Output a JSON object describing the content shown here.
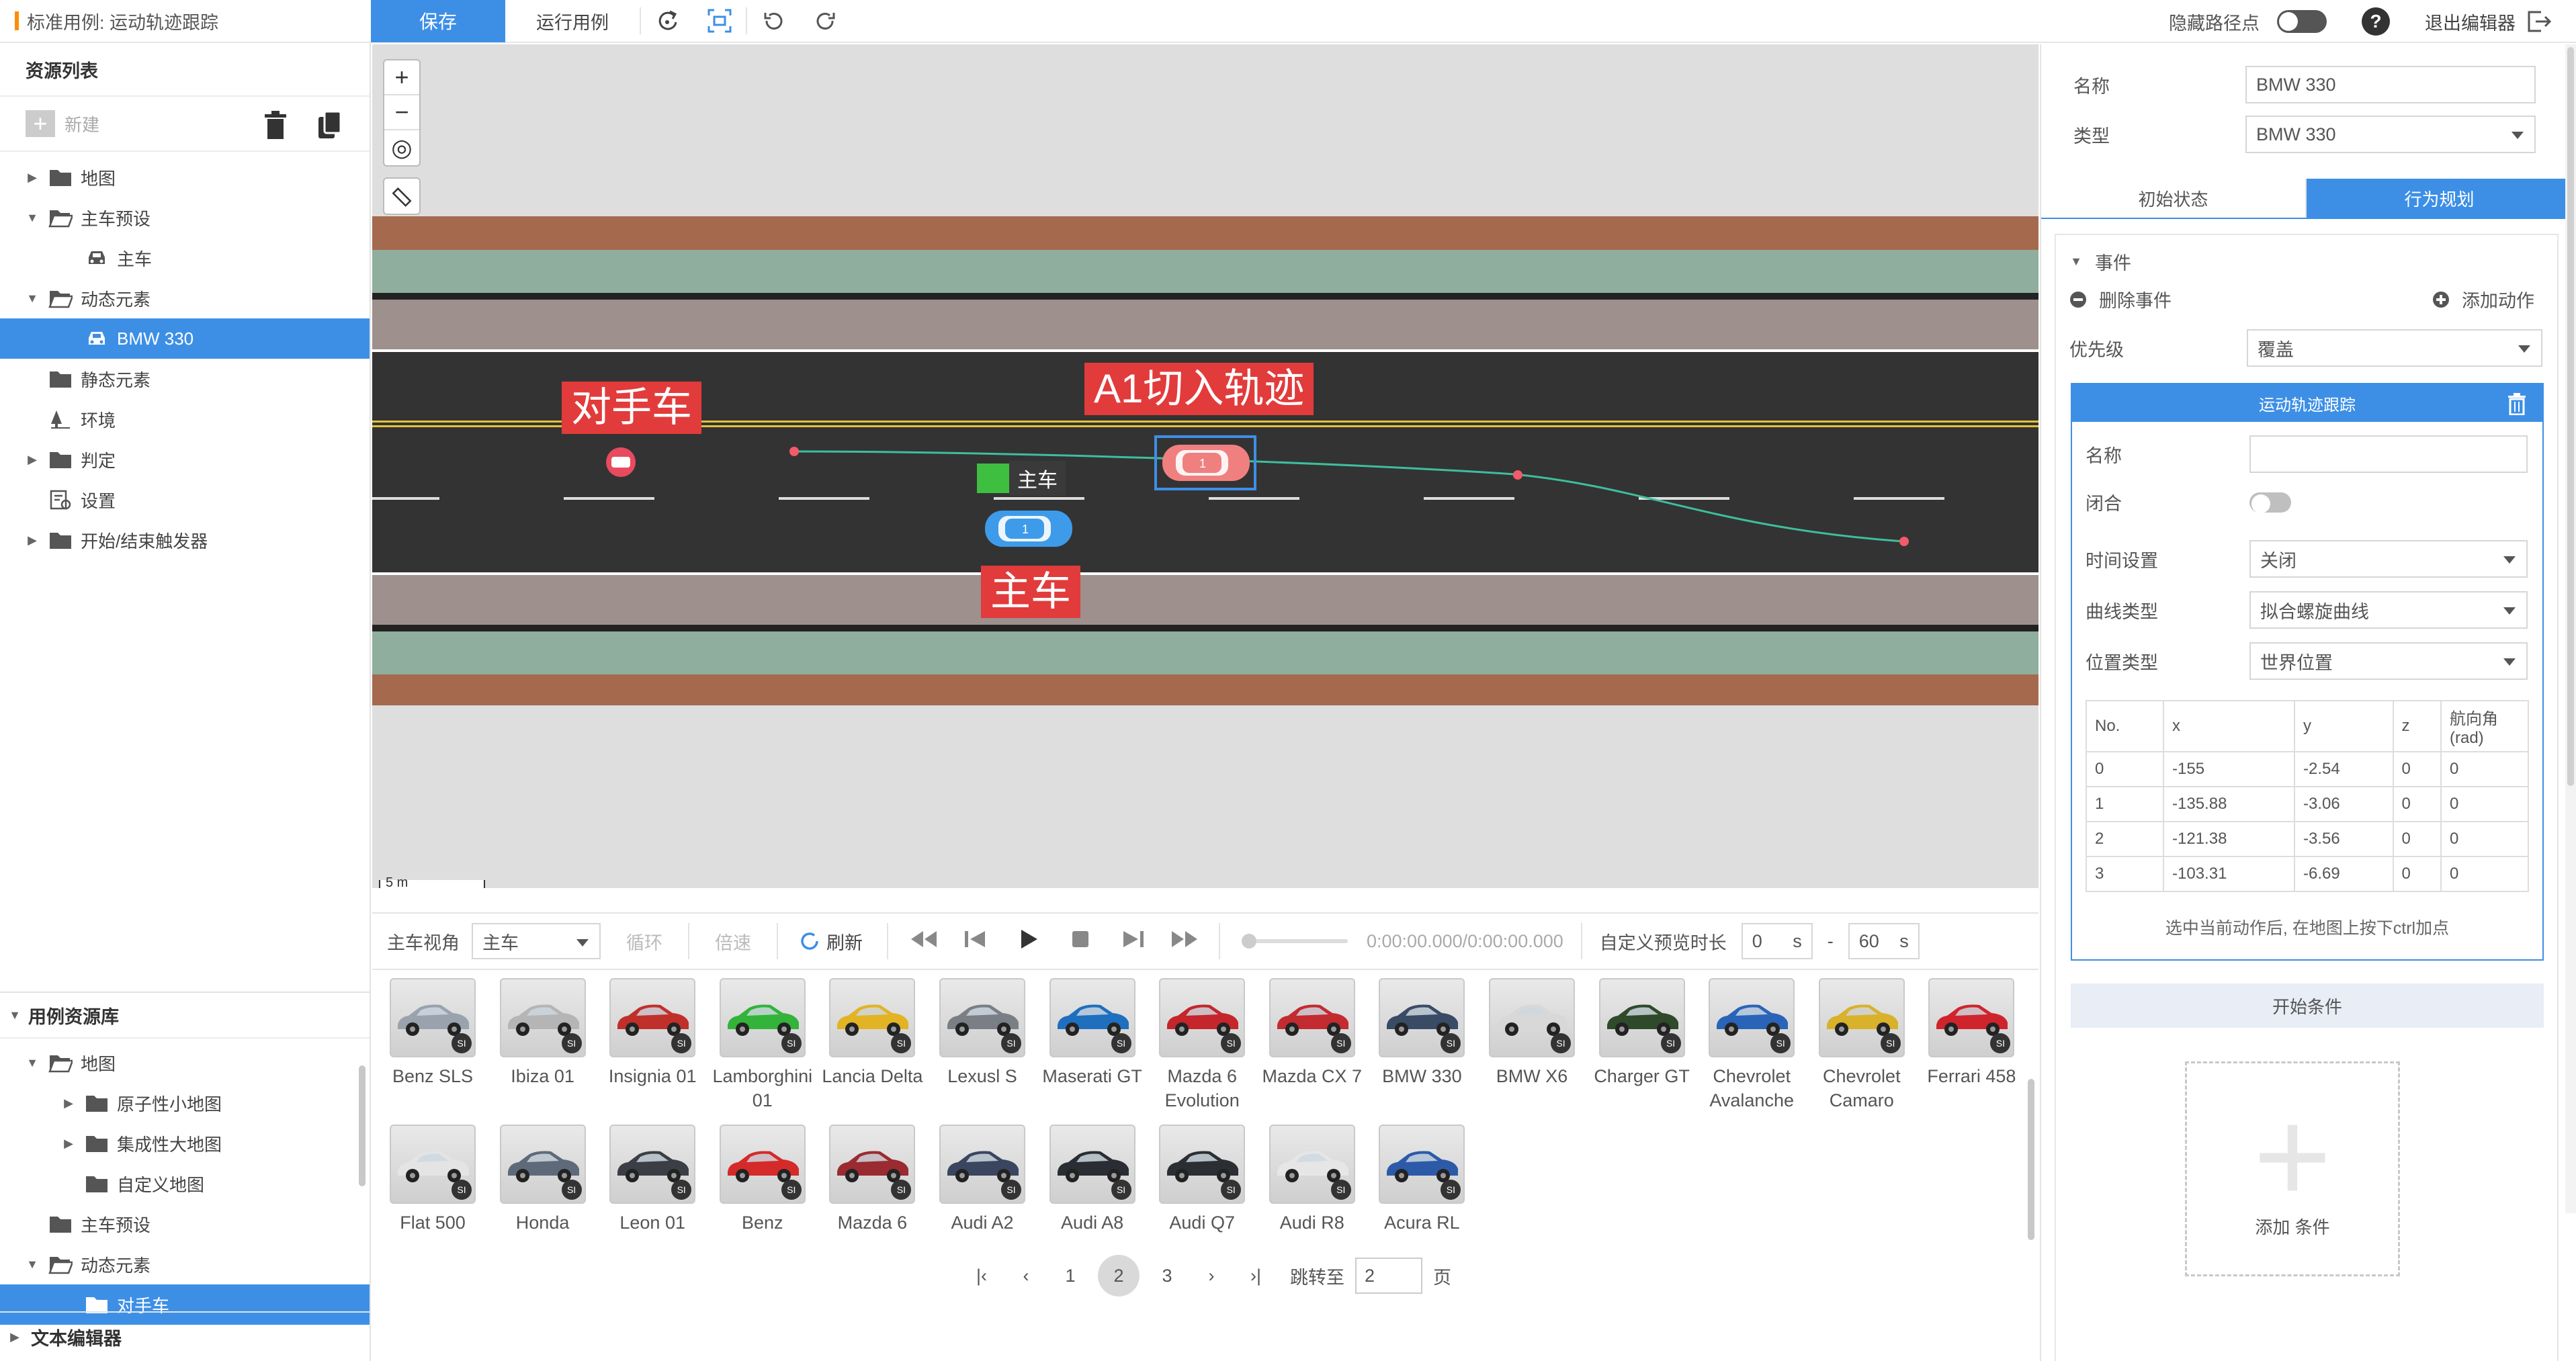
{
  "title_bar": {
    "title": "标准用例: 运动轨迹跟踪",
    "accent_color": "#ff8c00"
  },
  "toolbar": {
    "save_label": "保存",
    "run_label": "运行用例",
    "icons": [
      "refresh-route-icon",
      "fit-screen-icon",
      "undo-icon",
      "redo-icon"
    ],
    "hide_waypoints_label": "隐藏路径点",
    "help_label": "?",
    "exit_label": "退出编辑器"
  },
  "resources": {
    "title": "资源列表",
    "new_label": "新建",
    "tree": [
      {
        "label": "地图",
        "depth": 0,
        "caret": "▶",
        "icon": "folder"
      },
      {
        "label": "主车预设",
        "depth": 0,
        "caret": "▼",
        "icon": "folder-open"
      },
      {
        "label": "主车",
        "depth": 1,
        "caret": "",
        "icon": "car"
      },
      {
        "label": "动态元素",
        "depth": 0,
        "caret": "▼",
        "icon": "folder-open"
      },
      {
        "label": "BMW 330",
        "depth": 1,
        "caret": "",
        "icon": "car",
        "selected": true
      },
      {
        "label": "静态元素",
        "depth": 0,
        "caret": "",
        "icon": "folder"
      },
      {
        "label": "环境",
        "depth": 0,
        "caret": "",
        "icon": "tree"
      },
      {
        "label": "判定",
        "depth": 0,
        "caret": "▶",
        "icon": "folder"
      },
      {
        "label": "设置",
        "depth": 0,
        "caret": "",
        "icon": "settings"
      },
      {
        "label": "开始/结束触发器",
        "depth": 0,
        "caret": "▶",
        "icon": "folder"
      }
    ]
  },
  "case_library": {
    "title": "用例资源库",
    "tree": [
      {
        "label": "地图",
        "depth": 0,
        "caret": "▼",
        "icon": "folder-open"
      },
      {
        "label": "原子性小地图",
        "depth": 1,
        "caret": "▶",
        "icon": "folder"
      },
      {
        "label": "集成性大地图",
        "depth": 1,
        "caret": "▶",
        "icon": "folder"
      },
      {
        "label": "自定义地图",
        "depth": 1,
        "caret": "",
        "icon": "folder"
      },
      {
        "label": "主车预设",
        "depth": 0,
        "caret": "",
        "icon": "folder"
      },
      {
        "label": "动态元素",
        "depth": 0,
        "caret": "▼",
        "icon": "folder-open"
      },
      {
        "label": "对手车",
        "depth": 1,
        "caret": "",
        "icon": "folder",
        "selected": true
      }
    ]
  },
  "text_editor": {
    "label": "文本编辑器"
  },
  "map": {
    "zoom_in": "+",
    "zoom_out": "−",
    "annotations": {
      "opponent": "对手车",
      "trajectory": "A1切入轨迹",
      "ego": "主车"
    },
    "ego_tag": "主车",
    "scale_label": "5 m"
  },
  "playback": {
    "view_label": "主车视角",
    "view_value": "主车",
    "loop_label": "循环",
    "speed_label": "倍速",
    "refresh_label": "刷新",
    "time_text": "0:00:00.000/0:00:00.000",
    "preview_label": "自定义预览时长",
    "start_value": "0",
    "end_value": "60",
    "unit": "s",
    "dash": "-"
  },
  "gallery": {
    "badge": "SI",
    "row1": [
      {
        "name": "Benz SLS",
        "color": "#9aa3ad"
      },
      {
        "name": "Ibiza 01",
        "color": "#b5b5b5"
      },
      {
        "name": "Insignia 01",
        "color": "#c0302b"
      },
      {
        "name": "Lamborghini 01",
        "color": "#33b33a"
      },
      {
        "name": "Lancia Delta",
        "color": "#e2b324"
      },
      {
        "name": "Lexusl S",
        "color": "#7a7f85"
      },
      {
        "name": "Maserati GT",
        "color": "#1f6fbf"
      },
      {
        "name": "Mazda 6 Evolution",
        "color": "#c4262b"
      },
      {
        "name": "Mazda CX 7",
        "color": "#c22b30"
      },
      {
        "name": "BMW 330",
        "color": "#3a4b66"
      },
      {
        "name": "BMW X6",
        "color": "#d8d8d8"
      },
      {
        "name": "Charger GT",
        "color": "#2e4a2a"
      },
      {
        "name": "Chevrolet Avalanche",
        "color": "#2a64b8"
      },
      {
        "name": "Chevrolet Camaro",
        "color": "#d9b12a"
      },
      {
        "name": "Ferrari 458",
        "color": "#d0242c"
      }
    ],
    "row2": [
      {
        "name": "Flat 500",
        "color": "#e4e4e4"
      },
      {
        "name": "Honda",
        "color": "#5e6a7a"
      },
      {
        "name": "Leon 01",
        "color": "#3b3f45"
      },
      {
        "name": "Benz",
        "color": "#d42a2a"
      },
      {
        "name": "Mazda 6",
        "color": "#9a2b30"
      },
      {
        "name": "Audi A2",
        "color": "#3a4560"
      },
      {
        "name": "Audi A8",
        "color": "#2a2d33"
      },
      {
        "name": "Audi Q7",
        "color": "#2b2e33"
      },
      {
        "name": "Audi R8",
        "color": "#e6e6e6"
      },
      {
        "name": "Acura RL",
        "color": "#2d5aa8"
      }
    ]
  },
  "pager": {
    "first": "|‹",
    "prev": "‹",
    "pages": [
      "1",
      "2",
      "3"
    ],
    "current": "2",
    "next": "›",
    "last": "›|",
    "jump_label": "跳转至",
    "jump_value": "2",
    "page_suffix": "页"
  },
  "properties": {
    "name_label": "名称",
    "name_value": "BMW 330",
    "type_label": "类型",
    "type_value": "BMW 330",
    "tab_initial": "初始状态",
    "tab_behavior": "行为规划",
    "event_label": "事件",
    "delete_event": "删除事件",
    "add_action": "添加动作",
    "priority_label": "优先级",
    "priority_value": "覆盖",
    "track": {
      "title": "运动轨迹跟踪",
      "name_label": "名称",
      "name_value": "",
      "closed_label": "闭合",
      "time_label": "时间设置",
      "time_value": "关闭",
      "curve_label": "曲线类型",
      "curve_value": "拟合螺旋曲线",
      "pos_label": "位置类型",
      "pos_value": "世界位置",
      "columns": [
        "No.",
        "x",
        "y",
        "z",
        "航向角 (rad)"
      ],
      "rows": [
        [
          "0",
          "-155",
          "-2.54",
          "0",
          "0"
        ],
        [
          "1",
          "-135.88",
          "-3.06",
          "0",
          "0"
        ],
        [
          "2",
          "-121.38",
          "-3.56",
          "0",
          "0"
        ],
        [
          "3",
          "-103.31",
          "-6.69",
          "0",
          "0"
        ]
      ],
      "hint": "选中当前动作后, 在地图上按下ctrl加点"
    },
    "start_condition": "开始条件",
    "add_condition": "添加 条件"
  },
  "colors": {
    "primary": "#3d8fe6",
    "annotation_red": "#e23b3b",
    "road": "#333333"
  }
}
